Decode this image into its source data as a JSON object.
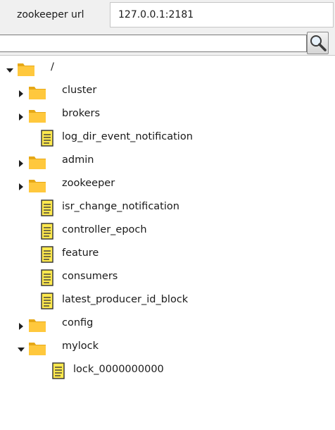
{
  "connection": {
    "label": "zookeeper url",
    "value": "127.0.0.1:2181"
  },
  "search": {
    "value": "",
    "button_icon": "magnifier-icon"
  },
  "colors": {
    "folder": "#FFC83D",
    "folder_dark": "#E6A817",
    "file": "#FFE94D",
    "file_border": "#3a3a3a"
  },
  "tree": {
    "nodes": [
      {
        "label": "/",
        "type": "folder",
        "depth": 0,
        "expanded": true
      },
      {
        "label": "cluster",
        "type": "folder",
        "depth": 1,
        "expanded": false
      },
      {
        "label": "brokers",
        "type": "folder",
        "depth": 1,
        "expanded": false
      },
      {
        "label": "log_dir_event_notification",
        "type": "file",
        "depth": 1
      },
      {
        "label": "admin",
        "type": "folder",
        "depth": 1,
        "expanded": false
      },
      {
        "label": "zookeeper",
        "type": "folder",
        "depth": 1,
        "expanded": false
      },
      {
        "label": "isr_change_notification",
        "type": "file",
        "depth": 1
      },
      {
        "label": "controller_epoch",
        "type": "file",
        "depth": 1
      },
      {
        "label": "feature",
        "type": "file",
        "depth": 1
      },
      {
        "label": "consumers",
        "type": "file",
        "depth": 1
      },
      {
        "label": "latest_producer_id_block",
        "type": "file",
        "depth": 1
      },
      {
        "label": "config",
        "type": "folder",
        "depth": 1,
        "expanded": false
      },
      {
        "label": "mylock",
        "type": "folder",
        "depth": 1,
        "expanded": true
      },
      {
        "label": "lock_0000000000",
        "type": "file",
        "depth": 2
      }
    ]
  }
}
